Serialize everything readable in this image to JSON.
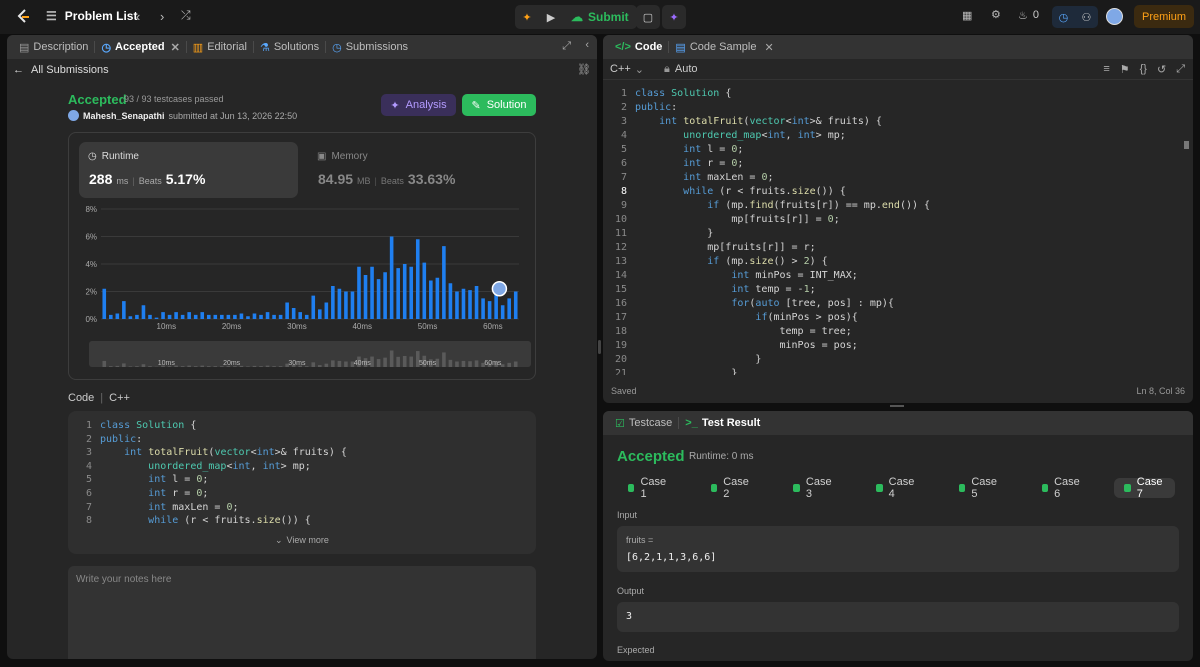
{
  "topbar": {
    "problem_list": "Problem List",
    "submit": "Submit",
    "streak": "0",
    "premium": "Premium"
  },
  "left": {
    "tabs": [
      {
        "label": "Description"
      },
      {
        "label": "Accepted"
      },
      {
        "label": "Editorial"
      },
      {
        "label": "Solutions"
      },
      {
        "label": "Submissions"
      }
    ],
    "all_submissions": "All Submissions",
    "status": "Accepted",
    "testcases": "93 / 93 testcases passed",
    "user": "Mahesh_Senapathi",
    "submitted": "submitted at Jun 13, 2026 22:50",
    "analysis_btn": "Analysis",
    "solution_btn": "Solution",
    "runtime": {
      "label": "Runtime",
      "value": "288",
      "unit": "ms",
      "beats_label": "Beats",
      "beats": "5.17%"
    },
    "memory": {
      "label": "Memory",
      "value": "84.95",
      "unit": "MB",
      "beats_label": "Beats",
      "beats": "33.63%"
    },
    "code_label": "Code",
    "lang": "C++",
    "view_more": "View more",
    "notes_placeholder": "Write your notes here"
  },
  "chart_data": {
    "type": "bar",
    "title": "",
    "xlabel": "",
    "ylabel": "",
    "y_ticks": [
      "8%",
      "6%",
      "4%",
      "2%",
      "0%"
    ],
    "x_ticks": [
      "10ms",
      "20ms",
      "30ms",
      "40ms",
      "50ms",
      "60ms"
    ],
    "ylim": [
      0,
      8
    ],
    "xlim": [
      0,
      64
    ],
    "series": [
      {
        "values": [
          2.2,
          0.3,
          0.4,
          1.3,
          0.2,
          0.3,
          1.0,
          0.3,
          0.1,
          0.5,
          0.3,
          0.5,
          0.3,
          0.5,
          0.3,
          0.5,
          0.3,
          0.3,
          0.3,
          0.3,
          0.3,
          0.4,
          0.2,
          0.4,
          0.3,
          0.5,
          0.3,
          0.3,
          1.2,
          0.8,
          0.5,
          0.3,
          1.7,
          0.7,
          1.2,
          2.4,
          2.2,
          2.0,
          2.0,
          3.8,
          3.2,
          3.8,
          2.9,
          3.4,
          6.0,
          3.7,
          4.0,
          3.8,
          5.8,
          4.1,
          2.8,
          3.0,
          5.3,
          2.6,
          2.0,
          2.2,
          2.1,
          2.4,
          1.5,
          1.3,
          1.9,
          1.0,
          1.5,
          2.0
        ]
      }
    ],
    "your_runtime": 288,
    "your_runtime_x": 61,
    "your_runtime_y": 2.2
  },
  "right": {
    "code_tab": "Code",
    "sample_tab": "Code Sample",
    "lang": "C++",
    "auto": "Auto",
    "saved": "Saved",
    "position": "Ln 8, Col 36",
    "testcase_tab": "Testcase",
    "result_tab": "Test Result",
    "result_status": "Accepted",
    "result_runtime": "Runtime: 0 ms",
    "cases": [
      "Case 1",
      "Case 2",
      "Case 3",
      "Case 4",
      "Case 5",
      "Case 6",
      "Case 7"
    ],
    "input_label": "Input",
    "input_var": "fruits =",
    "input_value": "[6,2,1,1,3,6,6]",
    "output_label": "Output",
    "output_value": "3",
    "expected_label": "Expected"
  },
  "code_lines": [
    "class Solution {",
    "public:",
    "    int totalFruit(vector<int>& fruits) {",
    "        unordered_map<int, int> mp;",
    "        int l = 0;",
    "        int r = 0;",
    "        int maxLen = 0;",
    "        while (r < fruits.size()) {",
    "            if (mp.find(fruits[r]) == mp.end()) {",
    "                mp[fruits[r]] = 0;",
    "            }",
    "            mp[fruits[r]] = r;",
    "            if (mp.size() > 2) {",
    "                int minPos = INT_MAX;",
    "                int temp = -1;",
    "                for(auto [tree, pos] : mp){",
    "                    if(minPos > pos){",
    "                        temp = tree;",
    "                        minPos = pos;",
    "                    }",
    "                }"
  ],
  "line_numbers": [
    "1",
    "2",
    "3",
    "4",
    "5",
    "6",
    "7",
    "8",
    "9",
    "10",
    "11",
    "12",
    "13",
    "14",
    "15",
    "16",
    "17",
    "18",
    "19",
    "20",
    "21"
  ],
  "colors": {
    "accent_green": "#2cbb5d",
    "accent_orange": "#ffa116",
    "bar_blue": "#1f7ff0",
    "purple": "#9b6bff"
  }
}
